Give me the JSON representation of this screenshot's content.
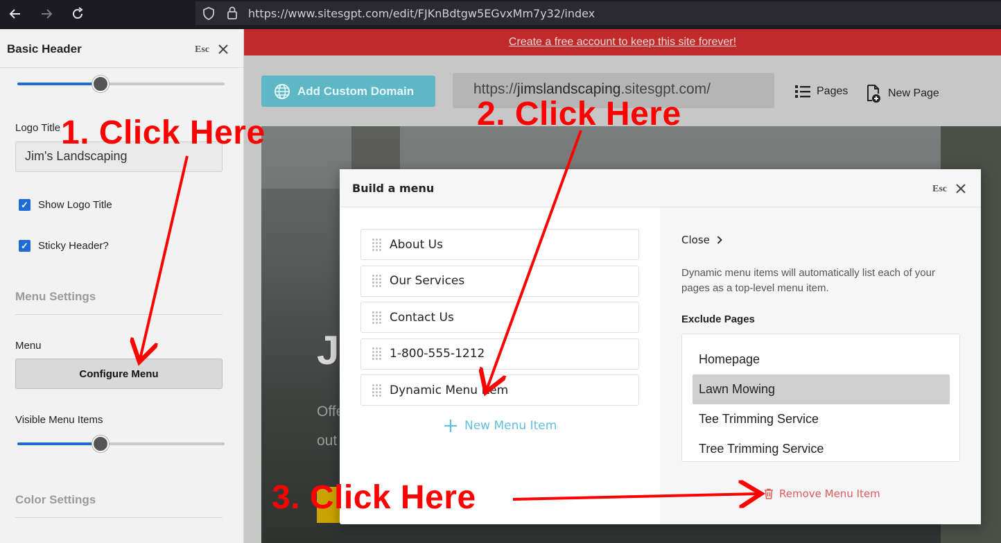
{
  "browser": {
    "url": "https://www.sitesgpt.com/edit/FJKnBdtgw5EGvxMm7y32/index",
    "icons": [
      "back-arrow-icon",
      "forward-arrow-icon",
      "reload-icon",
      "shield-icon",
      "lock-icon"
    ]
  },
  "panel": {
    "title": "Basic Header",
    "esc": "Esc",
    "top_slider_value": 0.4,
    "logo_title_label": "Logo Title",
    "logo_title_value": "Jim's Landscaping",
    "show_logo_title_label": "Show Logo Title",
    "show_logo_title_checked": true,
    "sticky_header_label": "Sticky Header?",
    "sticky_header_checked": true,
    "menu_settings_heading": "Menu Settings",
    "menu_label": "Menu",
    "configure_menu_label": "Configure Menu",
    "visible_menu_items_label": "Visible Menu Items",
    "visible_menu_items_value": 0.4,
    "color_settings_heading": "Color Settings"
  },
  "main": {
    "banner_text": "Create a free account to keep this site forever!",
    "add_domain_label": "Add Custom Domain",
    "site_url_prefix": "https://",
    "site_url_name": "jimslandscaping",
    "site_url_suffix": ".sitesgpt.com/",
    "pages_label": "Pages",
    "new_page_label": "New Page",
    "hero_heading_partial": "J",
    "hero_sub_line1": "Offe",
    "hero_sub_line2": "out"
  },
  "modal": {
    "title": "Build a menu",
    "esc": "Esc",
    "menu_items": [
      "About Us",
      "Our Services",
      "Contact Us",
      "1-800-555-1212",
      "Dynamic Menu Item"
    ],
    "new_menu_item_label": "New Menu Item",
    "close_label": "Close",
    "description": "Dynamic menu items will automatically list each of your pages as a top-level menu item.",
    "exclude_pages_label": "Exclude Pages",
    "exclude_pages": [
      "Homepage",
      "Lawn Mowing",
      "Tee Trimming Service",
      "Tree Trimming Service"
    ],
    "exclude_selected": "Lawn Mowing",
    "remove_menu_item_label": "Remove Menu Item"
  },
  "annotations": {
    "step1": "1. Click Here",
    "step2": "2. Click Here",
    "step3": "3. Click Here",
    "color": "#ff0000"
  },
  "colors": {
    "accent_blue": "#1e6bd6",
    "banner_red": "#c02a2a",
    "domain_button": "#5db7c4",
    "new_item_link": "#5fc0dd",
    "remove_link": "#e05a5a"
  }
}
